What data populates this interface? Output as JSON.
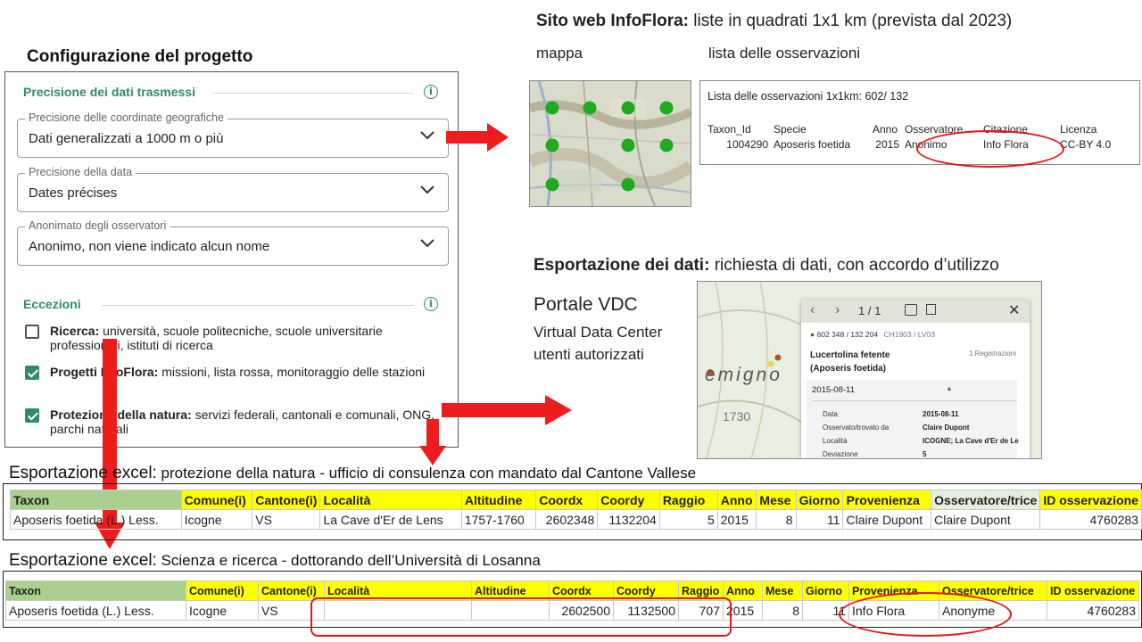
{
  "config": {
    "title": "Configurazione del progetto",
    "section_precision": "Precisione dei dati trasmessi",
    "fields": [
      {
        "legend": "Precisione delle coordinate geografiche",
        "value": "Dati generalizzati a 1000 m o più"
      },
      {
        "legend": "Precisione della data",
        "value": "Dates précises"
      },
      {
        "legend": "Anonimato degli osservatori",
        "value": "Anonimo, non viene indicato alcun nome"
      }
    ],
    "section_exceptions": "Eccezioni",
    "exceptions": [
      {
        "bold": "Ricerca:",
        "text": " università, scuole politecniche, scuole universitarie professionali, istituti di ricerca",
        "checked": false
      },
      {
        "bold": "Progetti InfoFlora:",
        "text": " missioni, lista rossa, monitoraggio delle stazioni",
        "checked": true
      },
      {
        "bold": "Protezione della natura:",
        "text": " servizi federali, cantonali e comunali, ONG, parchi naturali",
        "checked": true
      }
    ]
  },
  "website": {
    "title_bold": "Sito web InfoFlora:",
    "title_rest": " liste in quadrati 1x1 km (prevista dal 2023)",
    "map_label": "mappa",
    "list_label": "lista delle osservazioni",
    "list_title": "Lista delle osservazioni 1x1km:  602/ 132",
    "headers": [
      "Taxon_Id",
      "Specie",
      "Anno",
      "Osservatore",
      "Citazione",
      "Licenza"
    ],
    "row": [
      "1004290",
      "Aposeris foetida",
      "2015",
      "Anonimo",
      "Info Flora",
      "CC-BY 4.0"
    ]
  },
  "export": {
    "title_bold": "Esportazione dei dati:",
    "title_rest": " richiesta di dati, con accordo d’utilizzo",
    "portal": "Portale VDC",
    "portal_lines": [
      "Virtual Data Center",
      "utenti autorizzati"
    ],
    "card": {
      "pager": "1 / 1",
      "coords": "602 348 / 132 204",
      "coords_extra": "CH1903 / LV03",
      "species": "Lucertolina fetente",
      "species_latin": "(Aposeris foetida)",
      "registrations": "1 Registrazioni",
      "date": "2015-08-11",
      "details": [
        {
          "k": "Data",
          "v": "2015-08-11"
        },
        {
          "k": "Osservato/trovato da",
          "v": "Claire Dupont"
        },
        {
          "k": "Località",
          "v": "ICOGNE; La Cave d'Er de Le"
        },
        {
          "k": "Deviazione",
          "v": "5"
        }
      ],
      "map_text": "emigno",
      "map_alt": "1730"
    }
  },
  "excel1": {
    "title_bold": "Esportazione excel:",
    "title_rest": " protezione della natura - ufficio di consulenza con mandato dal Cantone Vallese",
    "headers": [
      "Taxon",
      "Comune(i)",
      "Cantone(i)",
      "Località",
      "Altitudine",
      "Coordx",
      "Coordy",
      "Raggio",
      "Anno",
      "Mese",
      "Giorno",
      "Provenienza",
      "Osservatore/trice",
      "ID osservazione"
    ],
    "row": [
      "Aposeris foetida (L.) Less.",
      "Icogne",
      "VS",
      "La Cave d'Er de Lens",
      "1757-1760",
      "2602348",
      "1132204",
      "5",
      "2015",
      "8",
      "11",
      "Claire Dupont",
      "Claire Dupont",
      "4760283"
    ]
  },
  "excel2": {
    "title_bold": "Esportazione excel:",
    "title_rest": "  Scienza e ricerca - dottorando dell’Università di Losanna",
    "headers": [
      "Taxon",
      "Comune(i)",
      "Cantone(i)",
      "Località",
      "Altitudine",
      "Coordx",
      "Coordy",
      "Raggio",
      "Anno",
      "Mese",
      "Giorno",
      "Provenienza",
      "Osservatore/trice",
      "ID osservazione"
    ],
    "row": [
      "Aposeris foetida (L.) Less.",
      "Icogne",
      "VS",
      "",
      "",
      "2602500",
      "1132500",
      "707",
      "2015",
      "8",
      "11",
      "Info Flora",
      "Anonyme",
      "4760283"
    ]
  },
  "colors": {
    "accent": "#2f8a6e",
    "arrow": "#ee1c1c",
    "header": "#ffff00",
    "taxon_header": "#a9d08e"
  }
}
